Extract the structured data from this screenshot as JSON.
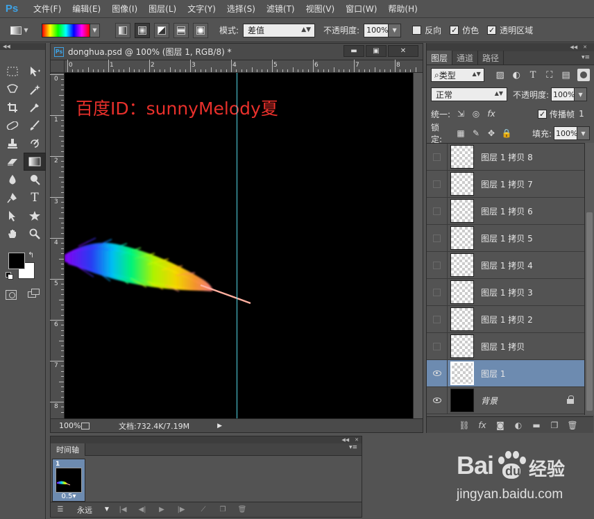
{
  "app": {
    "logo": "Ps",
    "menu": [
      "文件(F)",
      "编辑(E)",
      "图像(I)",
      "图层(L)",
      "文字(Y)",
      "选择(S)",
      "滤镜(T)",
      "视图(V)",
      "窗口(W)",
      "帮助(H)"
    ]
  },
  "options": {
    "mode_label": "模式:",
    "mode_value": "差值",
    "opacity_label": "不透明度:",
    "opacity_value": "100%",
    "reverse_label": "反向",
    "dither_label": "仿色",
    "transparency_label": "透明区域",
    "reverse_checked": false,
    "dither_checked": true,
    "transparency_checked": true
  },
  "document": {
    "icon": "Ps",
    "title": "donghua.psd @ 100% (图层 1, RGB/8) *",
    "ruler_h": [
      "0",
      "1",
      "2",
      "3",
      "4",
      "5",
      "6",
      "7",
      "8"
    ],
    "ruler_v": [
      "0",
      "1",
      "2",
      "3",
      "4",
      "5",
      "6",
      "7",
      "8"
    ],
    "canvas_text": "百度ID：sunnyMelody夏",
    "zoom": "100%",
    "doc_info": "文档:732.4K/7.19M",
    "canvas_bg": "#000000",
    "guide_color": "#55d8e8",
    "text_color": "#e8302b"
  },
  "timeline": {
    "tab": "时间轴",
    "frame_number": "1",
    "frame_delay": "0.5",
    "loop_value": "永远"
  },
  "layers": {
    "tabs": [
      "图层",
      "通道",
      "路径"
    ],
    "filter_value": "类型",
    "blend_mode": "正常",
    "opacity_label": "不透明度:",
    "opacity_value": "100%",
    "unify_label": "统一:",
    "propagate_label": "传播帧",
    "propagate_value": "1",
    "lock_label": "锁定:",
    "fill_label": "填充:",
    "fill_value": "100%",
    "items": [
      {
        "name": "图层 1 拷贝 8",
        "visible": false,
        "selected": false
      },
      {
        "name": "图层 1 拷贝 7",
        "visible": false,
        "selected": false
      },
      {
        "name": "图层 1 拷贝 6",
        "visible": false,
        "selected": false
      },
      {
        "name": "图层 1 拷贝 5",
        "visible": false,
        "selected": false
      },
      {
        "name": "图层 1 拷贝 4",
        "visible": false,
        "selected": false
      },
      {
        "name": "图层 1 拷贝 3",
        "visible": false,
        "selected": false
      },
      {
        "name": "图层 1 拷贝 2",
        "visible": false,
        "selected": false
      },
      {
        "name": "图层 1 拷贝",
        "visible": false,
        "selected": false
      },
      {
        "name": "图层 1",
        "visible": true,
        "selected": true
      },
      {
        "name": "背景",
        "visible": true,
        "selected": false,
        "locked": true
      }
    ]
  },
  "watermark": {
    "logo_left": "Bai",
    "logo_right": "经验",
    "url": "jingyan.baidu.com"
  }
}
